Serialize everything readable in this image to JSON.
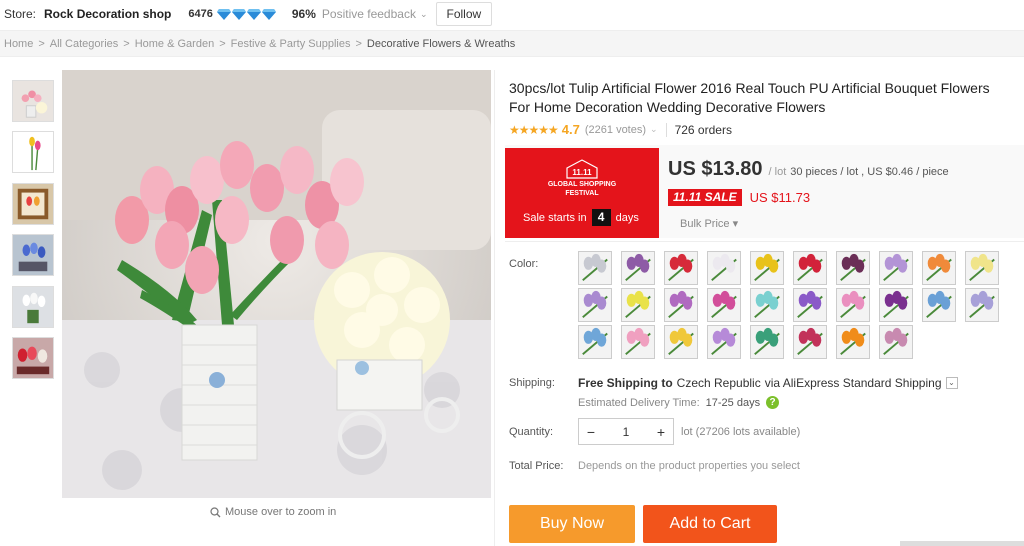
{
  "store": {
    "label": "Store:",
    "name": "Rock Decoration shop",
    "score": "6476",
    "diamond_count": 4,
    "diamond_color": "#2a8bd8",
    "positive_pct": "96%",
    "positive_label": "Positive feedback",
    "follow_label": "Follow"
  },
  "breadcrumb": [
    "Home",
    "All Categories",
    "Home & Garden",
    "Festive & Party Supplies",
    "Decorative Flowers & Wreaths"
  ],
  "gallery": {
    "thumb_icons": [
      "pink-tulip-bouquet",
      "single-tulip-stems",
      "tulips-framed",
      "blue-tulips",
      "white-tulips",
      "red-tulips"
    ],
    "zoom_hint": "Mouse over to zoom in"
  },
  "product": {
    "title": "30pcs/lot Tulip Artificial Flower 2016 Real Touch PU Artificial Bouquet Flowers For Home Decoration Wedding Decorative Flowers",
    "stars": "★★★★★",
    "rating": "4.7",
    "votes": "(2261 votes)",
    "orders": "726 orders"
  },
  "promo": {
    "logo_text": "11.11",
    "line1": "GLOBAL SHOPPING",
    "line2": "FESTIVAL",
    "sale_prefix": "Sale starts in",
    "days": "4",
    "sale_suffix": "days",
    "brand_color": "#e4141b"
  },
  "price": {
    "amount": "US $13.80",
    "unit": "/ lot",
    "pieces": "30 pieces / lot , US $0.46 / piece",
    "sale_badge": "11.11 SALE",
    "sale_price": "US $11.73",
    "bulk_label": "Bulk Price ▾"
  },
  "color": {
    "label": "Color:",
    "swatches": [
      "#c7c9d1",
      "#8e5ba6",
      "#d62a3a",
      "#ece9ef",
      "#e8c21a",
      "#d2223a",
      "#6b2e57",
      "#b394d6",
      "#f08a3a",
      "#f0e48a",
      "#a98ad0",
      "#e9e24a",
      "#b06ac0",
      "#d24e9a",
      "#7ad0d0",
      "#8a5ac8",
      "#ea8fbf",
      "#7a2f8f",
      "#6aa0d6",
      "#a7a0d8",
      "#6fa6d8",
      "#f0a0c0",
      "#f0c83a",
      "#b68ad8",
      "#3aa07a",
      "#c2325a",
      "#f08c1a",
      "#c88ab0"
    ]
  },
  "shipping": {
    "label": "Shipping:",
    "free": "Free Shipping to",
    "country": "Czech Republic",
    "via": "via AliExpress Standard Shipping",
    "delivery_label": "Estimated Delivery Time:",
    "delivery_days": "17-25 days",
    "help": "?"
  },
  "quantity": {
    "label": "Quantity:",
    "minus": "−",
    "value": "1",
    "plus": "+",
    "info": "lot (27206 lots available)"
  },
  "total": {
    "label": "Total Price:",
    "note": "Depends on the product properties you select"
  },
  "actions": {
    "buy_now": "Buy Now",
    "add_to_cart": "Add to Cart"
  }
}
